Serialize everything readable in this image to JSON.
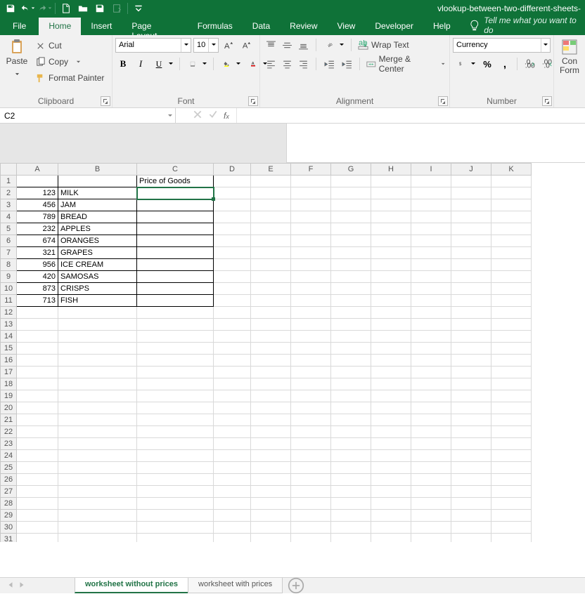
{
  "title": "vlookup-between-two-different-sheets-",
  "qat": {
    "customize": "Customize Quick Access Toolbar"
  },
  "tabs": {
    "file": "File",
    "home": "Home",
    "insert": "Insert",
    "page_layout": "Page Layout",
    "formulas": "Formulas",
    "data": "Data",
    "review": "Review",
    "view": "View",
    "developer": "Developer",
    "help": "Help",
    "tell": "Tell me what you want to do"
  },
  "ribbon": {
    "clipboard": {
      "label": "Clipboard",
      "paste": "Paste",
      "cut": "Cut",
      "copy": "Copy",
      "painter": "Format Painter"
    },
    "font": {
      "label": "Font",
      "name": "Arial",
      "size": "10",
      "bold": "B",
      "italic": "I",
      "underline": "U"
    },
    "alignment": {
      "label": "Alignment",
      "wrap": "Wrap Text",
      "merge": "Merge & Center"
    },
    "number": {
      "label": "Number",
      "format": "Currency"
    },
    "cells": {
      "cond": "Con",
      "format": "Form"
    }
  },
  "namebox": "C2",
  "formula": "",
  "columns": [
    "A",
    "B",
    "C",
    "D",
    "E",
    "F",
    "G",
    "H",
    "I",
    "J",
    "K"
  ],
  "rows_shown": 31,
  "selected": {
    "row": 2,
    "col": "C"
  },
  "header": {
    "c1": "Price of Goods"
  },
  "data": [
    {
      "r": 2,
      "a": "123",
      "b": "MILK"
    },
    {
      "r": 3,
      "a": "456",
      "b": "JAM"
    },
    {
      "r": 4,
      "a": "789",
      "b": "BREAD"
    },
    {
      "r": 5,
      "a": "232",
      "b": "APPLES"
    },
    {
      "r": 6,
      "a": "674",
      "b": "ORANGES"
    },
    {
      "r": 7,
      "a": "321",
      "b": "GRAPES"
    },
    {
      "r": 8,
      "a": "956",
      "b": "ICE CREAM"
    },
    {
      "r": 9,
      "a": "420",
      "b": "SAMOSAS"
    },
    {
      "r": 10,
      "a": "873",
      "b": "CRISPS"
    },
    {
      "r": 11,
      "a": "713",
      "b": "FISH"
    }
  ],
  "sheets": {
    "active": "worksheet without prices",
    "other": "worksheet with prices"
  },
  "colors": {
    "excel_green": "#0f7238",
    "accent": "#217346"
  }
}
